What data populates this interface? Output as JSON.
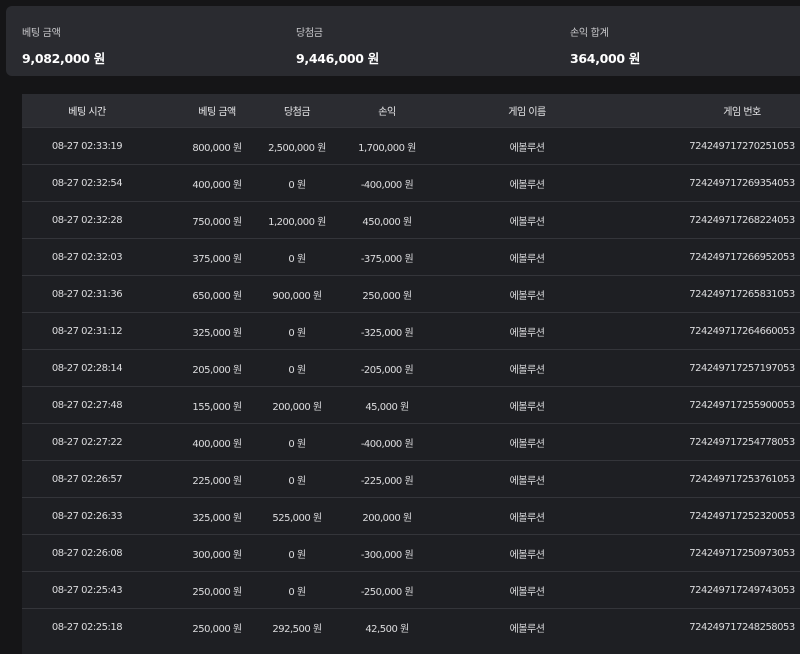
{
  "summary": {
    "bet_amount_label": "베팅 금액",
    "bet_amount_value": "9,082,000 원",
    "win_amount_label": "당첨금",
    "win_amount_value": "9,446,000 원",
    "profit_total_label": "손익 합계",
    "profit_total_value": "364,000 원"
  },
  "table": {
    "headers": [
      "베팅 시간",
      "베팅 금액",
      "당첨금",
      "손익",
      "게임 이름",
      "게임 번호"
    ],
    "rows": [
      [
        "08-27 02:33:19",
        "800,000 원",
        "2,500,000 원",
        "1,700,000 원",
        "에볼루션",
        "72424971727025105​3"
      ],
      [
        "08-27 02:32:54",
        "400,000 원",
        "0 원",
        "-400,000 원",
        "에볼루션",
        "724249717269354053"
      ],
      [
        "08-27 02:32:28",
        "750,000 원",
        "1,200,000 원",
        "450,000 원",
        "에볼루션",
        "724249717268224053"
      ],
      [
        "08-27 02:32:03",
        "375,000 원",
        "0 원",
        "-375,000 원",
        "에볼루션",
        "724249717266952053"
      ],
      [
        "08-27 02:31:36",
        "650,000 원",
        "900,000 원",
        "250,000 원",
        "에볼루션",
        "724249717265831053"
      ],
      [
        "08-27 02:31:12",
        "325,000 원",
        "0 원",
        "-325,000 원",
        "에볼루션",
        "724249717264660053"
      ],
      [
        "08-27 02:28:14",
        "205,000 원",
        "0 원",
        "-205,000 원",
        "에볼루션",
        "724249717257197053"
      ],
      [
        "08-27 02:27:48",
        "155,000 원",
        "200,000 원",
        "45,000 원",
        "에볼루션",
        "724249717255900053"
      ],
      [
        "08-27 02:27:22",
        "400,000 원",
        "0 원",
        "-400,000 원",
        "에볼루션",
        "724249717254778053"
      ],
      [
        "08-27 02:26:57",
        "225,000 원",
        "0 원",
        "-225,000 원",
        "에볼루션",
        "724249717253761053"
      ],
      [
        "08-27 02:26:33",
        "325,000 원",
        "525,000 원",
        "200,000 원",
        "에볼루션",
        "724249717252320053"
      ],
      [
        "08-27 02:26:08",
        "300,000 원",
        "0 원",
        "-300,000 원",
        "에볼루션",
        "724249717250973053"
      ],
      [
        "08-27 02:25:43",
        "250,000 원",
        "0 원",
        "-250,000 원",
        "에볼루션",
        "724249717249743053"
      ],
      [
        "08-27 02:25:18",
        "250,000 원",
        "292,500 원",
        "42,500 원",
        "에볼루션",
        "724249717248258053"
      ]
    ]
  }
}
